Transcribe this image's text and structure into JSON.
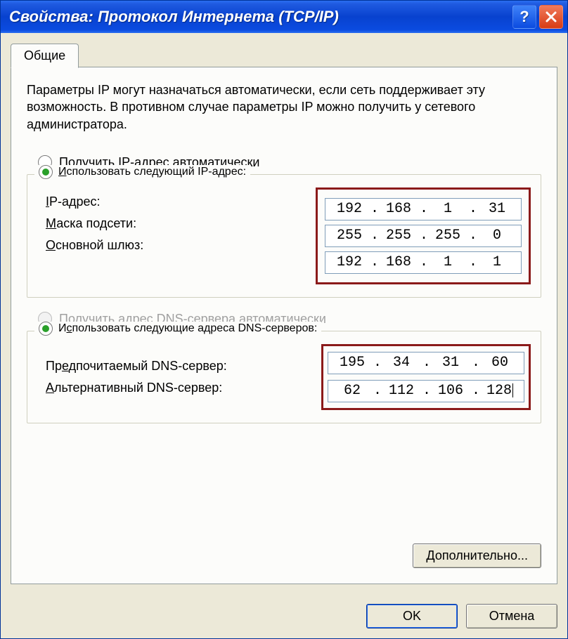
{
  "titlebar": {
    "title": "Свойства: Протокол Интернета (TCP/IP)"
  },
  "tab": {
    "label": "Общие"
  },
  "intro": "Параметры IP могут назначаться автоматически, если сеть поддерживает эту возможность. В противном случае параметры IP можно получить у сетевого администратора.",
  "ip_section": {
    "radio_auto": "Получить IP-адрес автоматически",
    "radio_manual": "Использовать следующий IP-адрес:",
    "rows": {
      "ip_label": "IP-адрес:",
      "mask_label": "Маска подсети:",
      "gateway_label": "Основной шлюз:"
    },
    "values": {
      "ip": [
        "192",
        "168",
        "1",
        "31"
      ],
      "mask": [
        "255",
        "255",
        "255",
        "0"
      ],
      "gateway": [
        "192",
        "168",
        "1",
        "1"
      ]
    }
  },
  "dns_section": {
    "radio_auto": "Получить адрес DNS-сервера автоматически",
    "radio_manual": "Использовать следующие адреса DNS-серверов:",
    "rows": {
      "preferred_label": "Предпочитаемый DNS-сервер:",
      "alternate_label": "Альтернативный DNS-сервер:"
    },
    "values": {
      "preferred": [
        "195",
        "34",
        "31",
        "60"
      ],
      "alternate": [
        "62",
        "112",
        "106",
        "128"
      ]
    }
  },
  "buttons": {
    "advanced": "Дополнительно...",
    "ok": "OK",
    "cancel": "Отмена"
  }
}
